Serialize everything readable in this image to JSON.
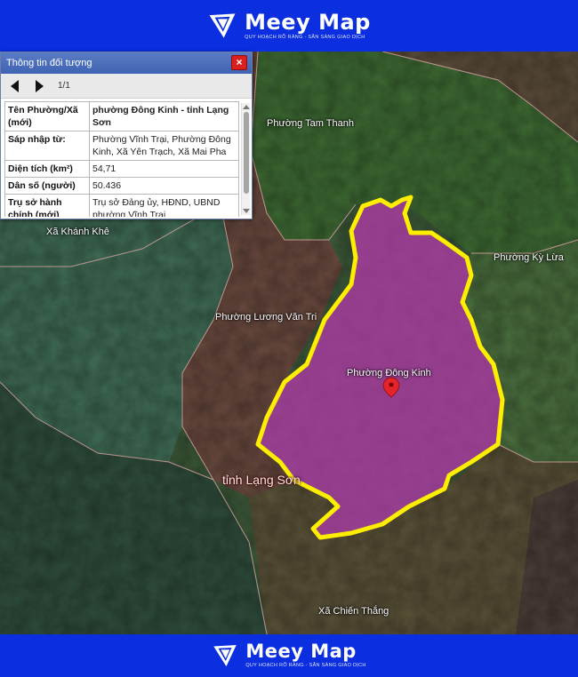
{
  "brand": {
    "name": "Meey Map",
    "tagline": "QUY HOẠCH RÕ RÀNG - SẴN SÀNG GIAO DỊCH",
    "color": "#0a2ee0"
  },
  "panel": {
    "title": "Thông tin đối tượng",
    "close_icon": "×",
    "pager": "1/1",
    "rows": [
      {
        "key": "Tên Phường/Xã (mới)",
        "value": "phường Đông Kinh - tỉnh Lạng Sơn"
      },
      {
        "key": "Sáp nhập từ:",
        "value": "Phường Vĩnh Trại, Phường Đông Kinh, Xã Yên Trạch, Xã Mai Pha"
      },
      {
        "key": "Diện tích (km²)",
        "value": "54,71"
      },
      {
        "key": "Dân số (người)",
        "value": "50.436"
      },
      {
        "key": "Trụ sở hành chính (mới)",
        "value": "Trụ sở Đảng ủy, HĐND, UBND phường Vĩnh Trại"
      }
    ]
  },
  "map": {
    "highlight_color": "#ffee00",
    "fill_color": "#b03aa6",
    "labels": {
      "tam_thanh": "Phường Tam Thanh",
      "khanh_khe": "Xã Khánh Khê",
      "ky_lua": "Phường Kỳ Lừa",
      "luong_van_tri": "Phường Lương Văn Tri",
      "dong_kinh": "Phường Đông Kinh",
      "lang_son": "tỉnh Lạng Sơn",
      "chien_thang": "Xã Chiến Thắng"
    }
  }
}
